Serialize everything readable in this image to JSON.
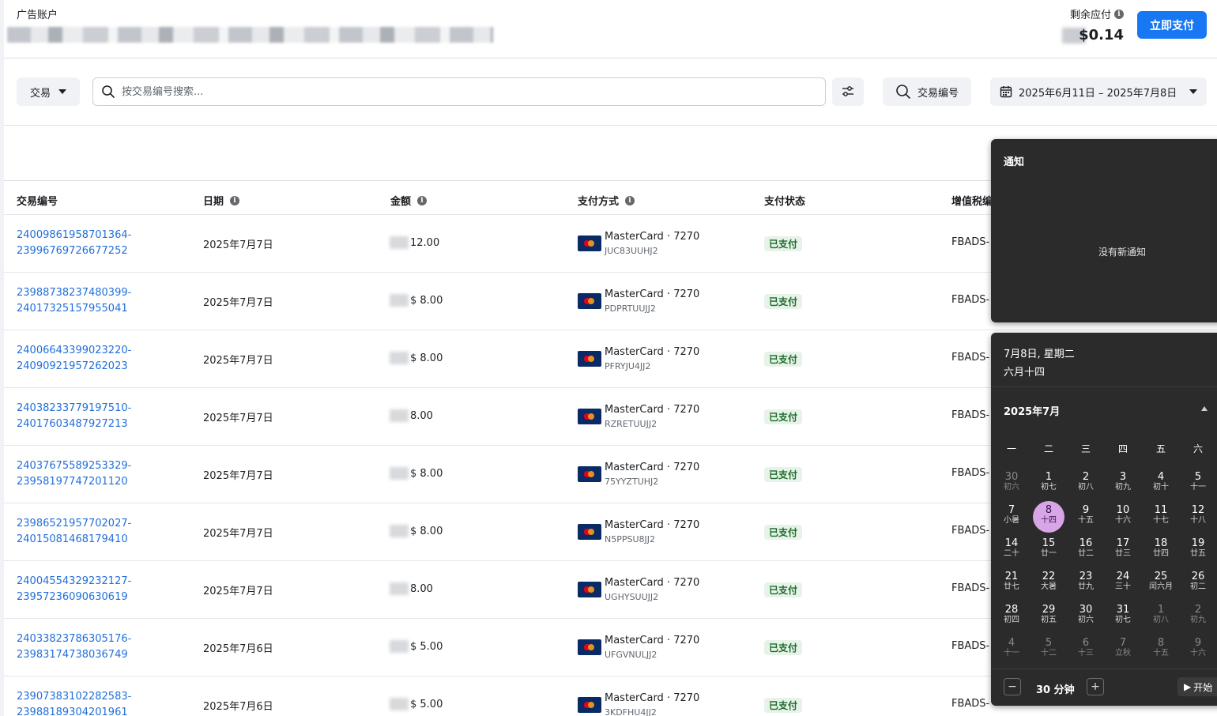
{
  "header": {
    "account_label": "广告账户",
    "due_label": "剩余应付",
    "due_amount": "$0.14",
    "pay_button": "立即支付"
  },
  "toolbar": {
    "type_dropdown": "交易",
    "search_placeholder": "按交易编号搜索...",
    "txn_button": "交易编号",
    "date_range": "2025年6月11日 – 2025年7月8日"
  },
  "table": {
    "columns": [
      "交易编号",
      "日期",
      "金额",
      "支付方式",
      "支付状态",
      "增值税编"
    ],
    "rows": [
      {
        "id1": "24009861958701364-",
        "id2": "23996769726677252",
        "date": "2025年7月7日",
        "amount": "12.00",
        "method": "MasterCard · 7270",
        "code": "JUC83UUHJ2",
        "status": "已支付",
        "vat": "FBADS-"
      },
      {
        "id1": "23988738237480399-",
        "id2": "24017325157955041",
        "date": "2025年7月7日",
        "amount": "$ 8.00",
        "method": "MasterCard · 7270",
        "code": "PDPRTUUJJ2",
        "status": "已支付",
        "vat": "FBADS-"
      },
      {
        "id1": "24006643399023220-",
        "id2": "24090921957262023",
        "date": "2025年7月7日",
        "amount": "$ 8.00",
        "method": "MasterCard · 7270",
        "code": "PFRYJU4JJ2",
        "status": "已支付",
        "vat": "FBADS-"
      },
      {
        "id1": "24038233779197510-",
        "id2": "24017603487927213",
        "date": "2025年7月7日",
        "amount": "8.00",
        "method": "MasterCard · 7270",
        "code": "RZRETUUJJ2",
        "status": "已支付",
        "vat": "FBADS-"
      },
      {
        "id1": "24037675589253329-",
        "id2": "23958197747201120",
        "date": "2025年7月7日",
        "amount": "$ 8.00",
        "method": "MasterCard · 7270",
        "code": "75YYZTUHJ2",
        "status": "已支付",
        "vat": "FBADS-"
      },
      {
        "id1": "23986521957702027-",
        "id2": "24015081468179410",
        "date": "2025年7月7日",
        "amount": "$ 8.00",
        "method": "MasterCard · 7270",
        "code": "N5PPSU8JJ2",
        "status": "已支付",
        "vat": "FBADS-"
      },
      {
        "id1": "24004554329232127-",
        "id2": "23957236090630619",
        "date": "2025年7月7日",
        "amount": "8.00",
        "method": "MasterCard · 7270",
        "code": "UGHYSUUJJ2",
        "status": "已支付",
        "vat": "FBADS-"
      },
      {
        "id1": "24033823786305176-",
        "id2": "23983174738036749",
        "date": "2025年7月6日",
        "amount": "$ 5.00",
        "method": "MasterCard · 7270",
        "code": "UFGVNULJJ2",
        "status": "已支付",
        "vat": "FBADS-"
      },
      {
        "id1": "23907383102282583-",
        "id2": "23988189304201961",
        "date": "2025年7月6日",
        "amount": "$ 5.00",
        "method": "MasterCard · 7270",
        "code": "3KDFHU4JJ2",
        "status": "已支付",
        "vat": "FBADS-"
      }
    ]
  },
  "notifications": {
    "title": "通知",
    "empty_text": "没有新通知"
  },
  "calendar": {
    "date_line": "7月8日, 星期二",
    "lunar_line": "六月十四",
    "month": "2025年7月",
    "weekdays": [
      "一",
      "二",
      "三",
      "四",
      "五",
      "六"
    ],
    "weeks": [
      [
        {
          "n": "30",
          "l": "初六",
          "dim": true
        },
        {
          "n": "1",
          "l": "初七"
        },
        {
          "n": "2",
          "l": "初八"
        },
        {
          "n": "3",
          "l": "初九"
        },
        {
          "n": "4",
          "l": "初十"
        },
        {
          "n": "5",
          "l": "十一"
        }
      ],
      [
        {
          "n": "7",
          "l": "小暑"
        },
        {
          "n": "8",
          "l": "十四",
          "today": true
        },
        {
          "n": "9",
          "l": "十五"
        },
        {
          "n": "10",
          "l": "十六"
        },
        {
          "n": "11",
          "l": "十七"
        },
        {
          "n": "12",
          "l": "十八"
        }
      ],
      [
        {
          "n": "14",
          "l": "二十"
        },
        {
          "n": "15",
          "l": "廿一"
        },
        {
          "n": "16",
          "l": "廿二"
        },
        {
          "n": "17",
          "l": "廿三"
        },
        {
          "n": "18",
          "l": "廿四"
        },
        {
          "n": "19",
          "l": "廿五"
        }
      ],
      [
        {
          "n": "21",
          "l": "廿七"
        },
        {
          "n": "22",
          "l": "大暑"
        },
        {
          "n": "23",
          "l": "廿九"
        },
        {
          "n": "24",
          "l": "三十"
        },
        {
          "n": "25",
          "l": "闰六月"
        },
        {
          "n": "26",
          "l": "初二"
        }
      ],
      [
        {
          "n": "28",
          "l": "初四"
        },
        {
          "n": "29",
          "l": "初五"
        },
        {
          "n": "30",
          "l": "初六"
        },
        {
          "n": "31",
          "l": "初七"
        },
        {
          "n": "1",
          "l": "初八",
          "dim": true
        },
        {
          "n": "2",
          "l": "初九",
          "dim": true
        }
      ],
      [
        {
          "n": "4",
          "l": "十一",
          "dim": true
        },
        {
          "n": "5",
          "l": "十二",
          "dim": true
        },
        {
          "n": "6",
          "l": "十三",
          "dim": true
        },
        {
          "n": "7",
          "l": "立秋",
          "dim": true
        },
        {
          "n": "8",
          "l": "十五",
          "dim": true
        },
        {
          "n": "9",
          "l": "十六",
          "dim": true
        }
      ]
    ],
    "timer": "30 分钟",
    "start": "开始"
  }
}
